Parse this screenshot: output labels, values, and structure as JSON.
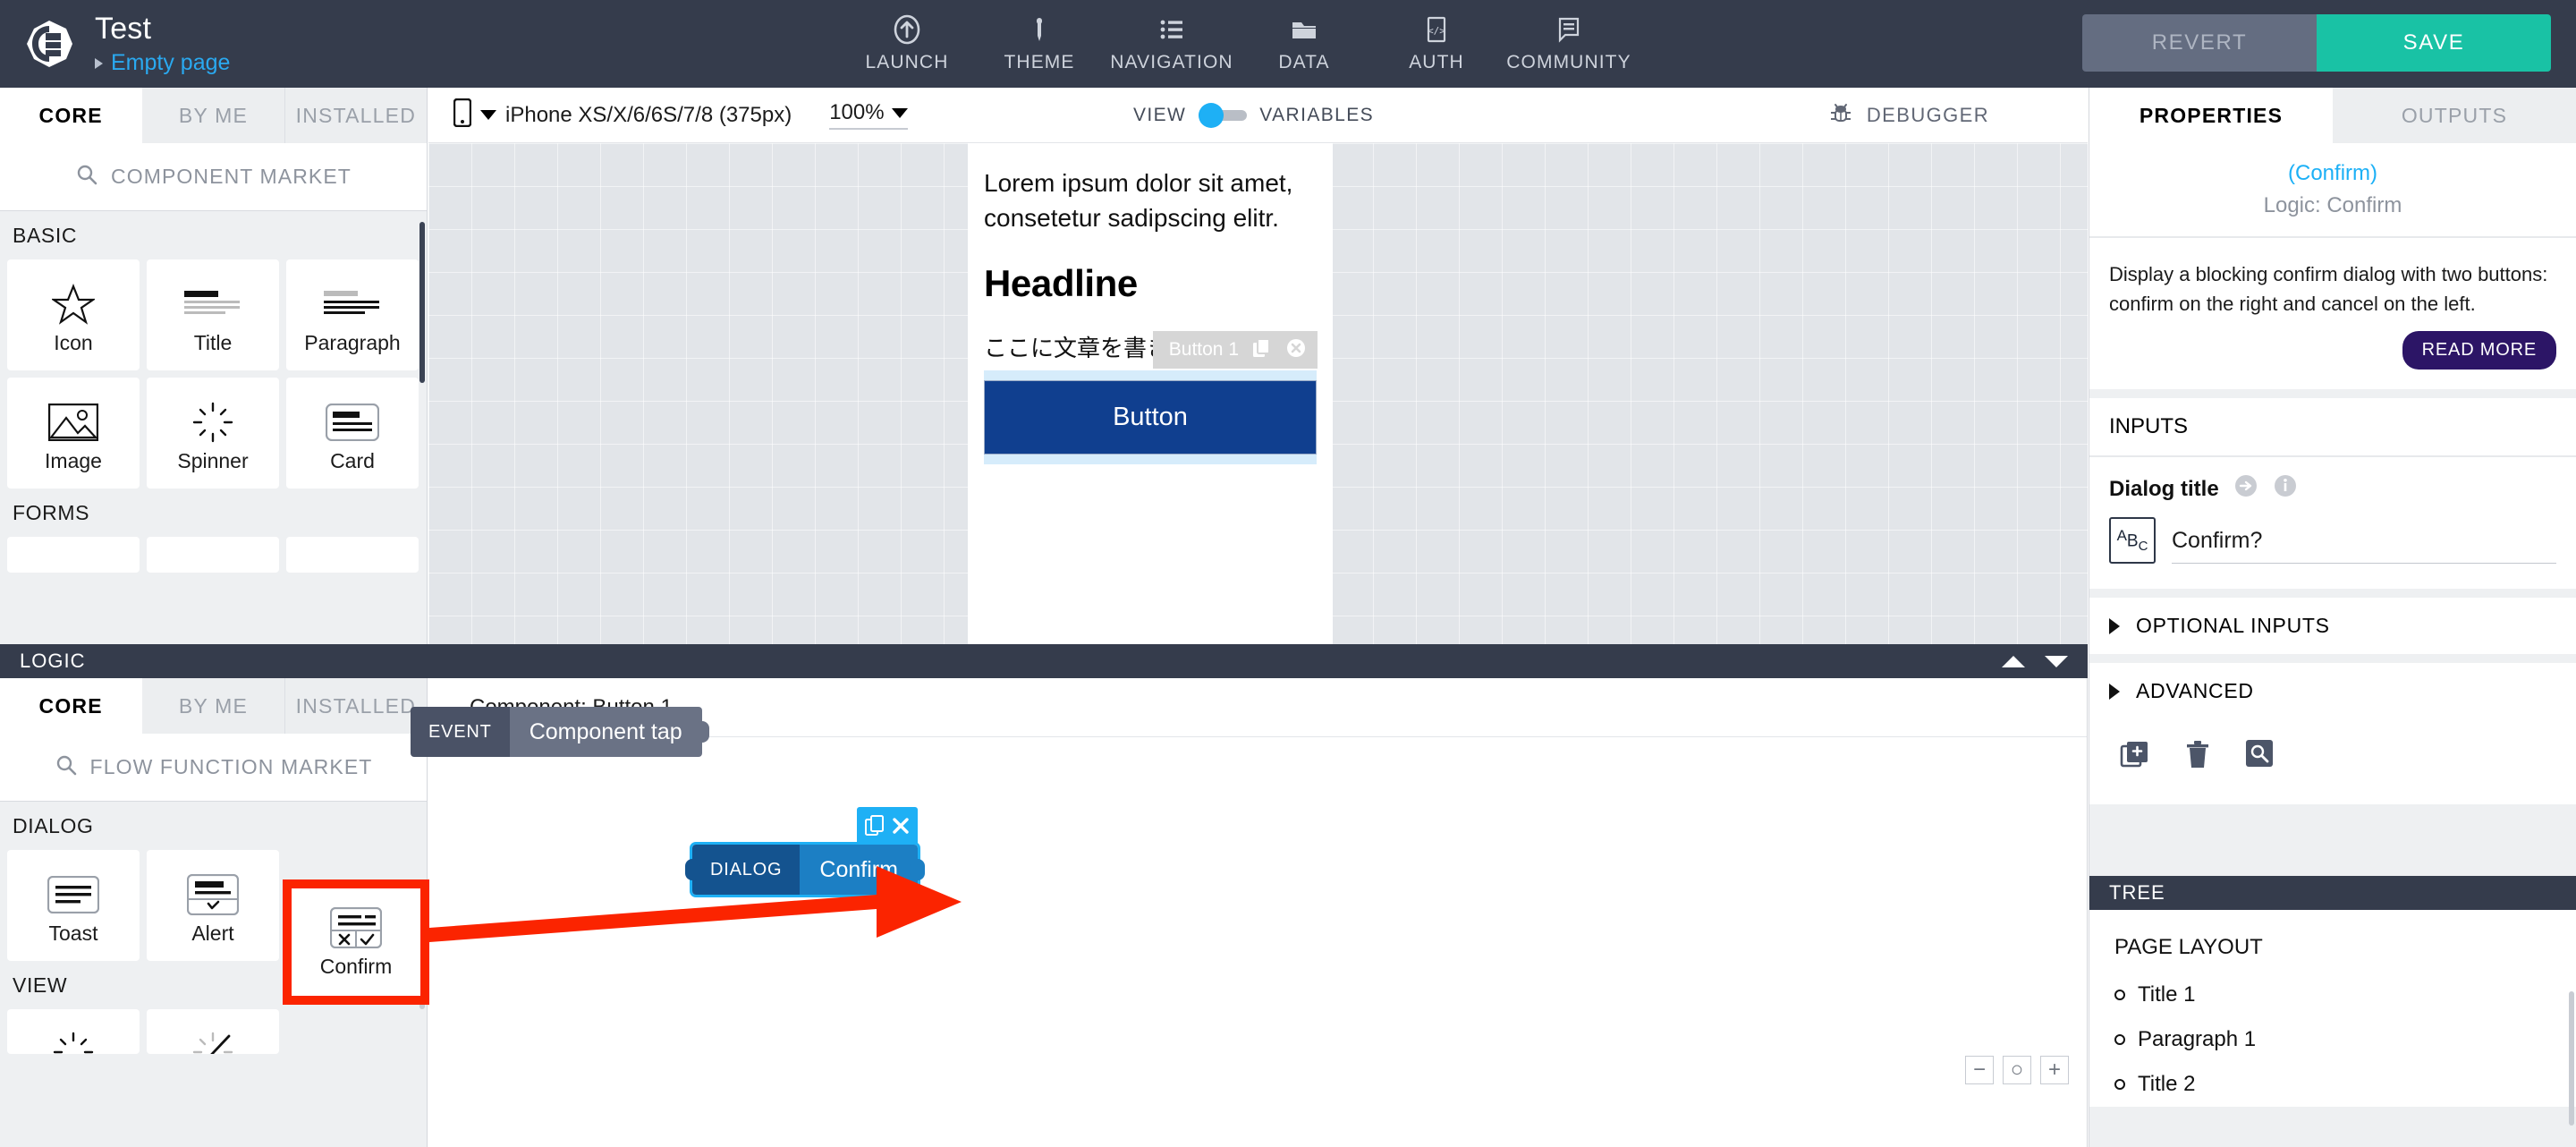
{
  "app": {
    "title": "Test",
    "page_breadcrumb": "Empty page",
    "logo_icon": "app-logo-icon"
  },
  "toolbar": {
    "items": [
      {
        "label": "LAUNCH",
        "icon": "launch-arrow-up-circle-icon"
      },
      {
        "label": "THEME",
        "icon": "eyedropper-icon"
      },
      {
        "label": "NAVIGATION",
        "icon": "list-icon"
      },
      {
        "label": "DATA",
        "icon": "folder-icon"
      },
      {
        "label": "AUTH",
        "icon": "code-file-icon"
      },
      {
        "label": "COMMUNITY",
        "icon": "speech-bubble-icon"
      }
    ],
    "revert_label": "REVERT",
    "save_label": "SAVE",
    "save_color": "#19c2a5",
    "revert_color": "#646d81"
  },
  "components_panel": {
    "tabs": [
      {
        "label": "CORE",
        "active": true
      },
      {
        "label": "BY ME",
        "active": false
      },
      {
        "label": "INSTALLED",
        "active": false
      }
    ],
    "search_label": "COMPONENT MARKET",
    "search_icon": "search-icon",
    "sections": [
      {
        "title": "BASIC",
        "rows": [
          [
            {
              "label": "Icon",
              "icon": "star-icon"
            },
            {
              "label": "Title",
              "icon": "title-lines-icon"
            },
            {
              "label": "Paragraph",
              "icon": "paragraph-lines-icon"
            }
          ],
          [
            {
              "label": "Image",
              "icon": "image-icon"
            },
            {
              "label": "Spinner",
              "icon": "spinner-icon"
            },
            {
              "label": "Card",
              "icon": "card-icon"
            }
          ]
        ]
      },
      {
        "title": "FORMS",
        "rows": [
          [
            {
              "label": "",
              "icon": "blank-tile"
            },
            {
              "label": "",
              "icon": "blank-tile"
            },
            {
              "label": "",
              "icon": "blank-tile"
            }
          ]
        ]
      }
    ]
  },
  "canvas_toolbar": {
    "device_icon": "phone-icon",
    "device_name": "iPhone XS/X/6/6S/7/8 (375px)",
    "zoom_level": "100%",
    "view_label": "VIEW",
    "variables_label": "VARIABLES",
    "toggle_position": "view",
    "debugger_label": "DEBUGGER",
    "debugger_icon": "bug-icon"
  },
  "preview": {
    "paragraph": "Lorem ipsum dolor sit amet, consetetur sadipscing elitr.",
    "headline": "Headline",
    "japanese_text": "ここに文章を書きます。",
    "button_label": "Button",
    "selected_badge": {
      "label": "Button 1",
      "copy_icon": "copy-icon",
      "close_icon": "close-circle-icon"
    }
  },
  "logic_bar": {
    "title": "LOGIC",
    "collapse_up_icon": "triangle-up-icon",
    "collapse_down_icon": "triangle-down-icon"
  },
  "logic_panel": {
    "tabs": [
      {
        "label": "CORE",
        "active": true
      },
      {
        "label": "BY ME",
        "active": false
      },
      {
        "label": "INSTALLED",
        "active": false
      }
    ],
    "search_label": "FLOW FUNCTION MARKET",
    "search_icon": "search-icon",
    "sections": [
      {
        "title": "DIALOG",
        "rows": [
          [
            {
              "label": "Toast",
              "icon": "toast-icon",
              "highlighted": false
            },
            {
              "label": "Alert",
              "icon": "alert-icon",
              "highlighted": false
            },
            {
              "label": "Confirm",
              "icon": "confirm-icon",
              "highlighted": true
            }
          ]
        ]
      },
      {
        "title": "VIEW",
        "rows": [
          [
            {
              "label": "",
              "icon": "spinner-icon"
            },
            {
              "label": "",
              "icon": "spinner-slash-icon"
            }
          ]
        ]
      }
    ],
    "highlight_color": "#fb2400"
  },
  "flow": {
    "header": "Component: Button 1",
    "nodes": [
      {
        "kind": "EVENT",
        "name": "Component tap",
        "type": "event"
      },
      {
        "kind": "DIALOG",
        "name": "Confirm",
        "type": "dialog",
        "selected": true,
        "copy_icon": "copy-icon",
        "close_icon": "close-x-icon"
      }
    ],
    "zoom_controls": [
      {
        "label": "−",
        "name": "zoom-out-button"
      },
      {
        "label": "○",
        "name": "zoom-reset-button"
      },
      {
        "label": "+",
        "name": "zoom-in-button"
      }
    ]
  },
  "properties_panel": {
    "tabs": [
      {
        "label": "PROPERTIES",
        "active": true
      },
      {
        "label": "OUTPUTS",
        "active": false
      }
    ],
    "node_title": "(Confirm)",
    "node_subtitle": "Logic: Confirm",
    "description": "Display a blocking confirm dialog with two buttons: confirm on the right and cancel on the left.",
    "read_more_label": "READ MORE",
    "read_more_color": "#2c1566",
    "inputs_header": "INPUTS",
    "inputs": [
      {
        "label": "Dialog title",
        "value": "Confirm?",
        "type_badge": "ABC",
        "connect_icon": "arrow-right-circle-icon",
        "info_icon": "info-circle-icon"
      }
    ],
    "accordions": [
      {
        "label": "OPTIONAL INPUTS",
        "expanded": false
      },
      {
        "label": "ADVANCED",
        "expanded": false
      }
    ],
    "action_icons": [
      {
        "name": "add-copy-icon"
      },
      {
        "name": "trash-icon"
      },
      {
        "name": "search-box-icon"
      }
    ]
  },
  "tree_panel": {
    "title": "TREE",
    "group_label": "PAGE LAYOUT",
    "items": [
      {
        "label": "Title 1"
      },
      {
        "label": "Paragraph 1"
      },
      {
        "label": "Title 2"
      }
    ]
  }
}
